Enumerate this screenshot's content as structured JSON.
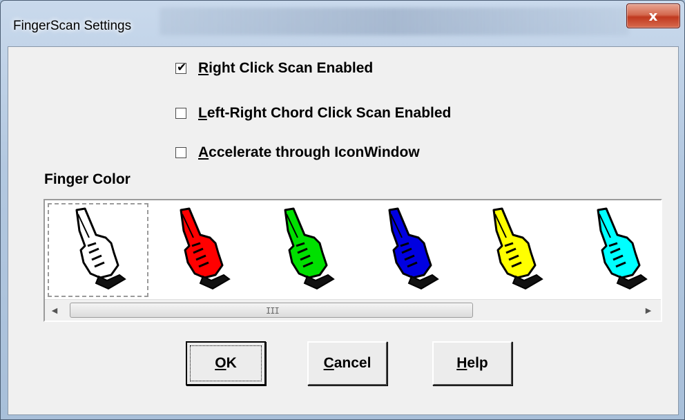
{
  "window": {
    "title": "FingerScan Settings",
    "close_glyph": "x"
  },
  "options": [
    {
      "label_underline": "R",
      "label_rest": "ight Click Scan Enabled",
      "checked": true
    },
    {
      "label_underline": "L",
      "label_rest": "eft-Right Chord Click Scan Enabled",
      "checked": false
    },
    {
      "label_underline": "A",
      "label_rest": "ccelerate through IconWindow",
      "checked": false
    }
  ],
  "finger_color": {
    "label": "Finger Color",
    "icon": "pointing-hand-icon",
    "swatches": [
      {
        "name": "white",
        "color": "#ffffff",
        "selected": true
      },
      {
        "name": "red",
        "color": "#ff0000",
        "selected": false
      },
      {
        "name": "green",
        "color": "#00e000",
        "selected": false
      },
      {
        "name": "blue",
        "color": "#0000e0",
        "selected": false
      },
      {
        "name": "yellow",
        "color": "#ffff00",
        "selected": false
      },
      {
        "name": "cyan",
        "color": "#00ffff",
        "selected": false
      }
    ],
    "scroll_grip": "III"
  },
  "buttons": {
    "ok_u": "O",
    "ok_rest": "K",
    "cancel_u": "C",
    "cancel_rest": "ancel",
    "help_u": "H",
    "help_rest": "elp"
  }
}
